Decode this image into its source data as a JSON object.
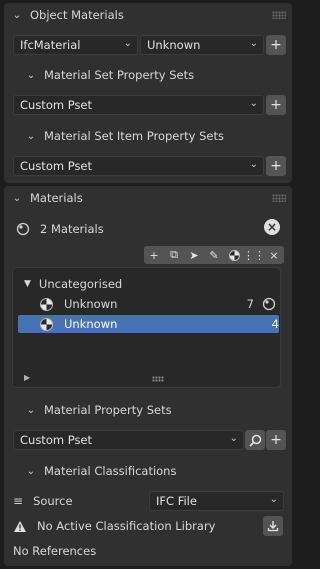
{
  "object_materials": {
    "title": "Object Materials",
    "material_type": "IfcMaterial",
    "material_value": "Unknown",
    "set_psets_title": "Material Set Property Sets",
    "set_psets_value": "Custom Pset",
    "set_item_psets_title": "Material Set Item Property Sets",
    "set_item_psets_value": "Custom Pset"
  },
  "materials": {
    "title": "Materials",
    "count_label": "2 Materials",
    "toolbar_icons": [
      "add-icon",
      "duplicate-icon",
      "select-icon",
      "edit-icon",
      "material-icon",
      "unlink-icon",
      "close-icon"
    ],
    "group_label": "Uncategorised",
    "items": [
      {
        "name": "Unknown",
        "count": "7",
        "selected": false
      },
      {
        "name": "Unknown",
        "count": "4",
        "selected": true
      }
    ],
    "property_sets_title": "Material Property Sets",
    "property_sets_value": "Custom Pset",
    "classifications_title": "Material Classifications",
    "source_label": "Source",
    "source_value": "IFC File",
    "no_library_text": "No Active Classification Library",
    "no_references_text": "No References"
  },
  "colors": {
    "selected_row": "#4772b3",
    "panel": "#303030",
    "background": "#1d1d1d"
  }
}
